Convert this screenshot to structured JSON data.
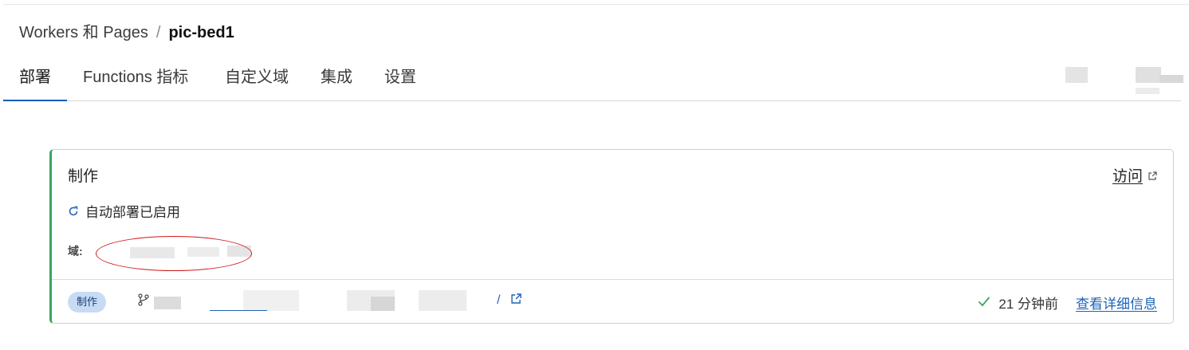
{
  "breadcrumb": {
    "root": "Workers 和 Pages",
    "separator": "/",
    "current": "pic-bed1"
  },
  "tabs": [
    {
      "label": "部署",
      "active": true
    },
    {
      "label": "Functions 指标",
      "active": false
    },
    {
      "label": "自定义域",
      "active": false
    },
    {
      "label": "集成",
      "active": false
    },
    {
      "label": "设置",
      "active": false
    }
  ],
  "card": {
    "title": "制作",
    "visit_label": "访问",
    "auto_deploy_text": "自动部署已启用",
    "domain_label": "域:",
    "deployment": {
      "badge": "制作",
      "status_time": "21 分钟前",
      "details_link": "查看详细信息"
    }
  },
  "icons": {
    "external": "external-link-icon",
    "refresh": "refresh-icon",
    "branch": "git-branch-icon",
    "check": "check-icon"
  },
  "colors": {
    "accent": "#0b5cb8",
    "success": "#3aa55d",
    "link": "#1f62b8",
    "badge_bg": "#c8dbf5"
  }
}
